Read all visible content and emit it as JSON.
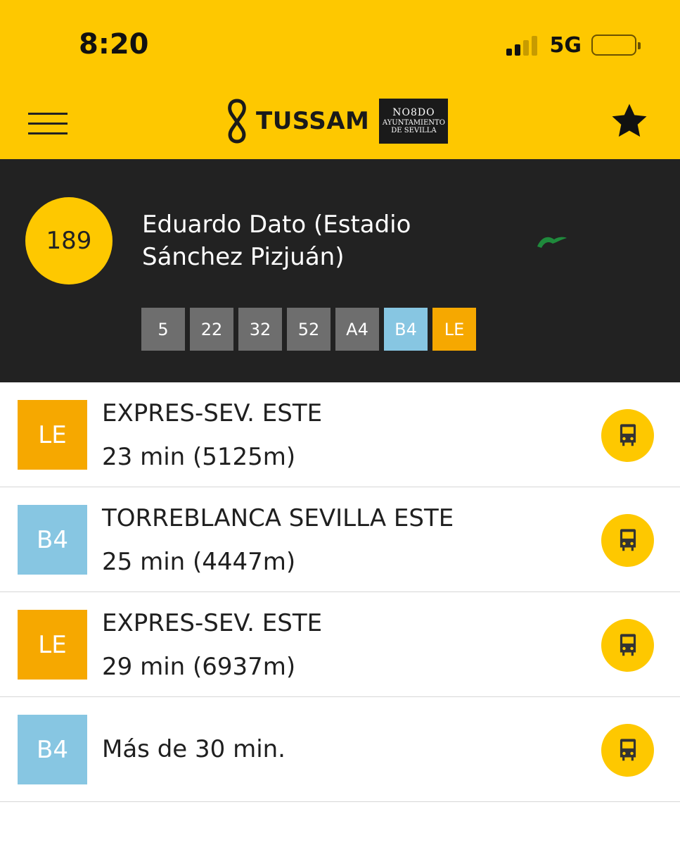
{
  "status_bar": {
    "time": "8:20",
    "network": "5G"
  },
  "header": {
    "logo_text": "TUSSAM",
    "partner_logo": {
      "line1": "NO8DO",
      "line2": "AYUNTAMIENTO",
      "line3": "DE SEVILLA"
    },
    "menu_icon": "hamburger-icon",
    "favorite_icon": "star-icon"
  },
  "stop": {
    "number": "189",
    "name_line1": "Eduardo Dato (Estadio",
    "name_line2": "Sánchez Pizjuán)",
    "lines": [
      {
        "label": "5",
        "color": "#6e6e6e"
      },
      {
        "label": "22",
        "color": "#6e6e6e"
      },
      {
        "label": "32",
        "color": "#6e6e6e"
      },
      {
        "label": "52",
        "color": "#6e6e6e"
      },
      {
        "label": "A4",
        "color": "#6e6e6e"
      },
      {
        "label": "B4",
        "color": "#87c6e2"
      },
      {
        "label": "LE",
        "color": "#f6a800"
      }
    ]
  },
  "arrivals": [
    {
      "line": "LE",
      "color": "#f6a800",
      "destination": "EXPRES-SEV. ESTE",
      "eta": "23 min (5125m)"
    },
    {
      "line": "B4",
      "color": "#87c6e2",
      "destination": "TORREBLANCA SEVILLA ESTE",
      "eta": "25 min (4447m)"
    },
    {
      "line": "LE",
      "color": "#f6a800",
      "destination": "EXPRES-SEV. ESTE",
      "eta": "29 min (6937m)"
    },
    {
      "line": "B4",
      "color": "#87c6e2",
      "destination": "",
      "eta": "Más de 30 min."
    }
  ],
  "colors": {
    "brand_yellow": "#fec800",
    "panel_dark": "#222222"
  }
}
